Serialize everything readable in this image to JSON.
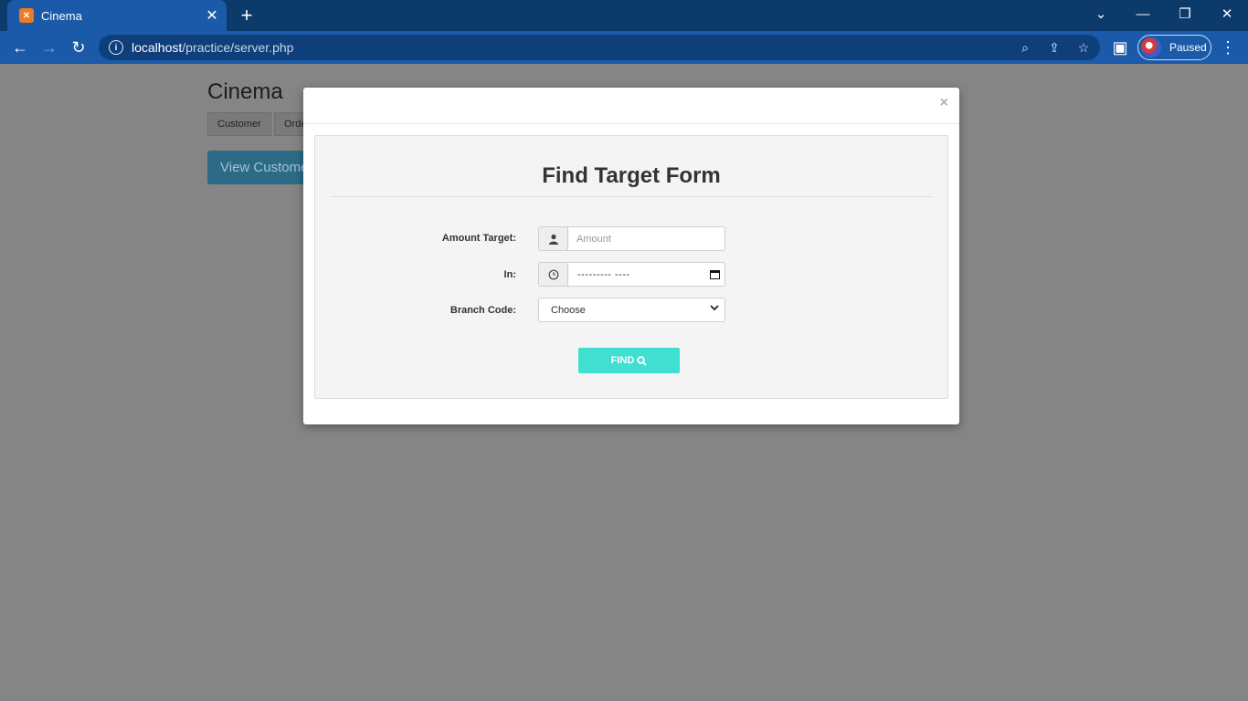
{
  "browser": {
    "tab_title": "Cinema",
    "tab_favicon": "xampp-icon",
    "url_host": "localhost",
    "url_path": "/practice/server.php",
    "profile_label": "Paused"
  },
  "page": {
    "title": "Cinema",
    "tabs": [
      "Customer",
      "Orde"
    ],
    "view_button": "View Custome"
  },
  "modal": {
    "close_label": "×",
    "form_title": "Find Target Form",
    "fields": {
      "amount_label": "Amount Target:",
      "amount_placeholder": "Amount",
      "in_label": "In:",
      "in_value": "--------- ----",
      "branch_label": "Branch Code:",
      "branch_selected": "Choose"
    },
    "find_label": "FIND"
  },
  "colors": {
    "find_button": "#40dfd2",
    "chrome_dark": "#0c3a6b",
    "chrome_light": "#1a5aa8"
  }
}
